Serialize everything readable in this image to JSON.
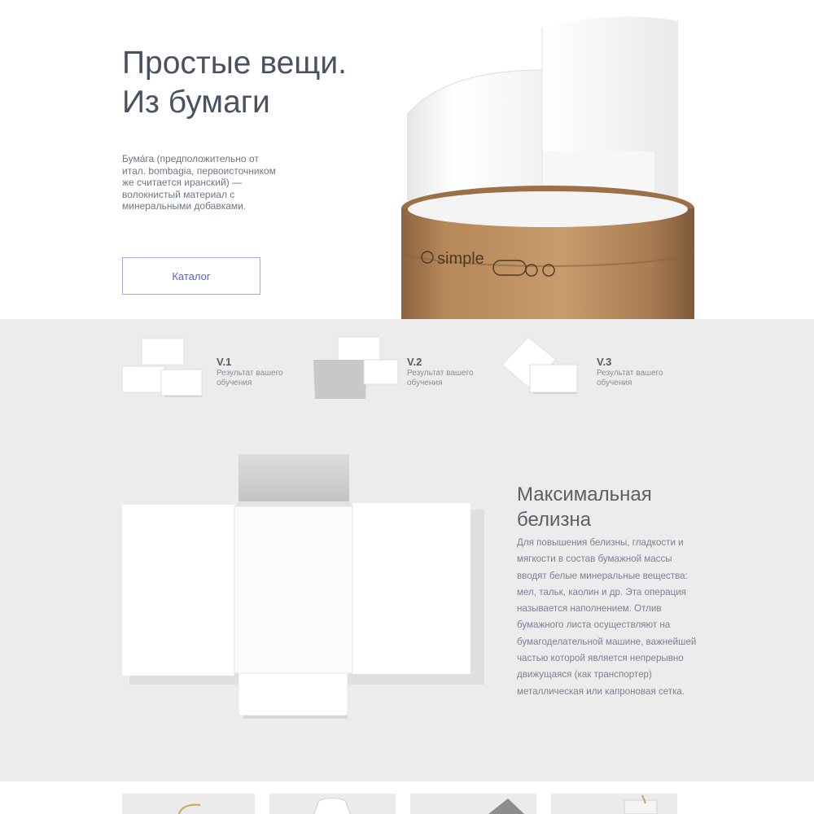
{
  "hero": {
    "title_line1": "Простые вещи.",
    "title_line2": "Из бумаги",
    "description": "Бума́га (предположительно от итал. bombagia, первоисточником же считается иранский) — волокнистый материал с минеральными добавками.",
    "button_label": "Каталог",
    "tube_brand": "simple"
  },
  "versions": [
    {
      "title": "V.1",
      "subtitle": "Результат вашего обучения"
    },
    {
      "title": "V.2",
      "subtitle": "Результат вашего обучения"
    },
    {
      "title": "V.3",
      "subtitle": "Результат вашего обучения"
    }
  ],
  "feature": {
    "title_line1": "Максимальная",
    "title_line2": "белизна",
    "body": "Для повышения белизны, гладкости и мягкости в состав бумажной массы вводят белые минеральные вещества: мел, тальк, каолин и др. Эта операция называется наполнением. Отлив бумажного листа осуществляют на бумагоделательной машине, важнейшей частью которой является непрерывно движущаяся (как транспортер) металлическая или капроновая сетка."
  },
  "colors": {
    "title": "#4a5260",
    "accent": "#5961cf",
    "button_border": "#a5a8ee",
    "grey_background": "#ececec",
    "kraft": "#b7875a"
  }
}
